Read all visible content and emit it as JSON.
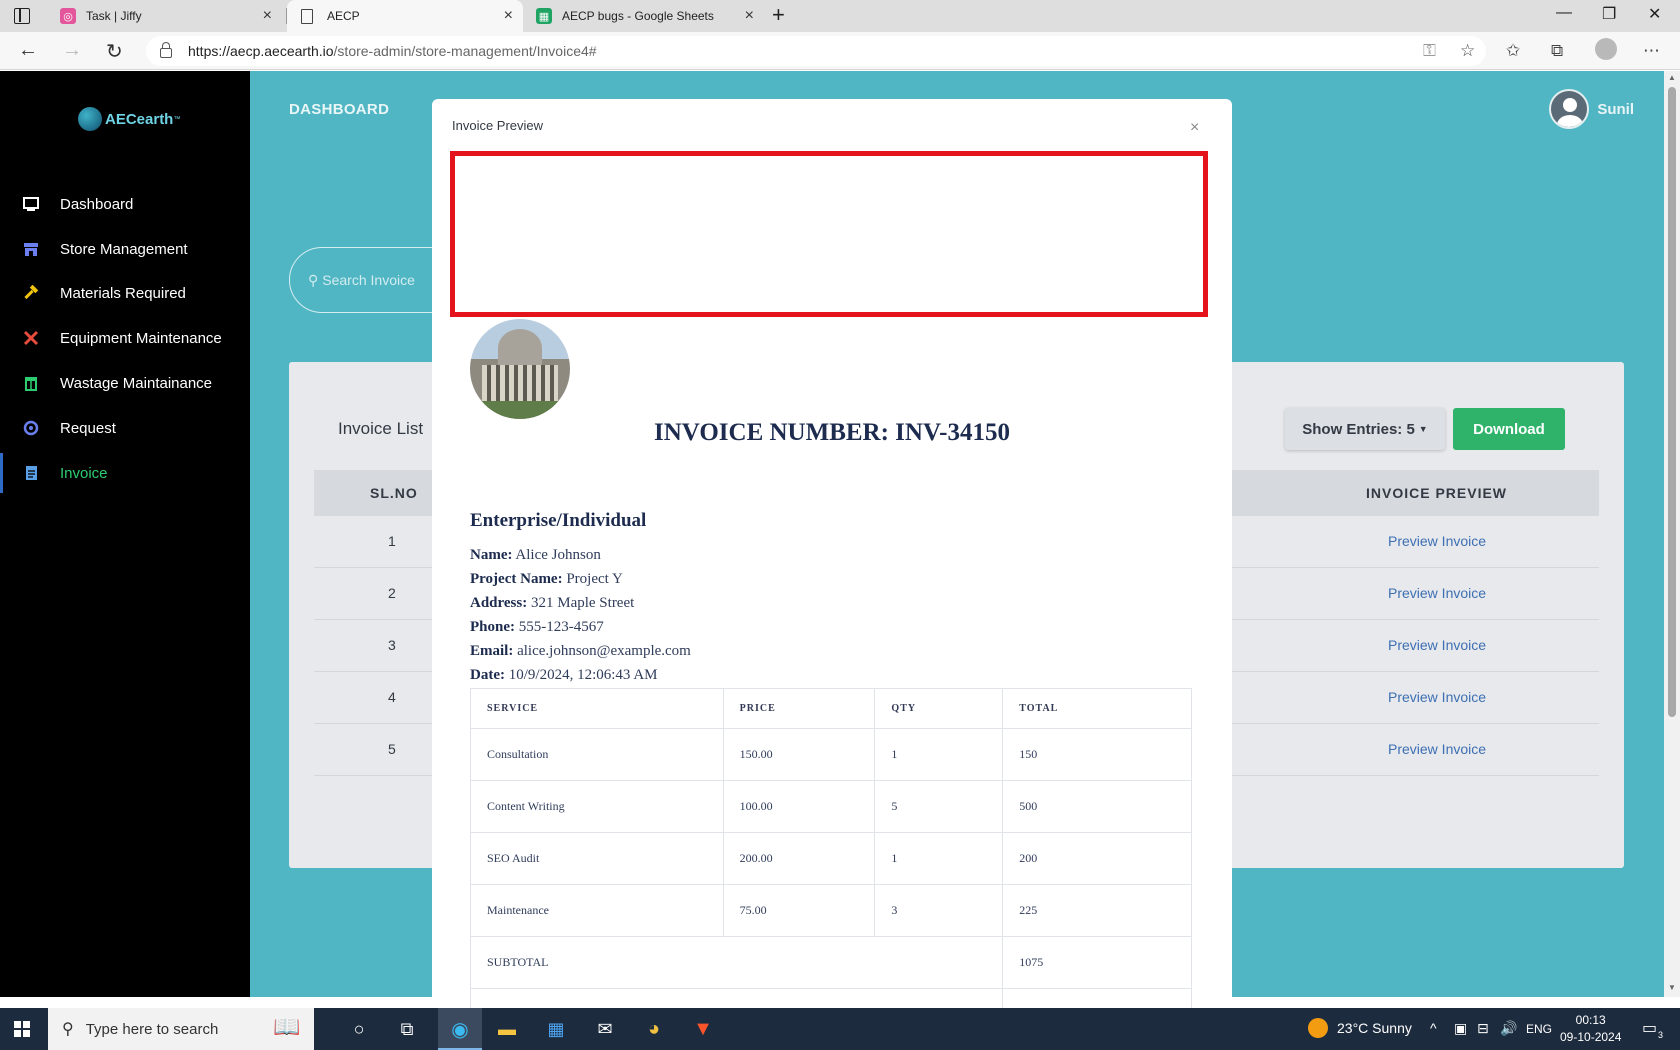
{
  "browser": {
    "tabs": [
      {
        "title": "Task | Jiffy"
      },
      {
        "title": "AECP"
      },
      {
        "title": "AECP bugs - Google Sheets"
      }
    ],
    "url_host": "https://aecp.aecearth.io",
    "url_path": "/store-admin/store-management/Invoice4#"
  },
  "sidebar": {
    "logo_text": "AECearth",
    "logo_tm": "™",
    "items": [
      {
        "label": "Dashboard",
        "icon": "monitor-icon"
      },
      {
        "label": "Store Management",
        "icon": "store-icon"
      },
      {
        "label": "Materials Required",
        "icon": "hammer-icon"
      },
      {
        "label": "Equipment Maintenance",
        "icon": "tools-icon"
      },
      {
        "label": "Wastage Maintainance",
        "icon": "trash-icon"
      },
      {
        "label": "Request",
        "icon": "request-icon"
      },
      {
        "label": "Invoice",
        "icon": "document-icon"
      }
    ],
    "active": "Invoice"
  },
  "header": {
    "title": "DASHBOARD",
    "user_name": "Sunil"
  },
  "search": {
    "placeholder": "Search Invoice"
  },
  "invoice_list": {
    "title": "Invoice List",
    "show_entries": "Show Entries: 5",
    "download": "Download",
    "columns": [
      "SL.NO",
      "INVOICE PREVIEW"
    ],
    "rows": [
      {
        "sl": "1",
        "preview": "Preview Invoice"
      },
      {
        "sl": "2",
        "preview": "Preview Invoice"
      },
      {
        "sl": "3",
        "preview": "Preview Invoice"
      },
      {
        "sl": "4",
        "preview": "Preview Invoice"
      },
      {
        "sl": "5",
        "preview": "Preview Invoice"
      }
    ]
  },
  "modal": {
    "title": "Invoice Preview",
    "close": "×",
    "invoice_number": "INVOICE NUMBER: INV-34150",
    "section": "Enterprise/Individual",
    "fields": [
      {
        "label": "Name:",
        "value": "Alice Johnson"
      },
      {
        "label": "Project Name:",
        "value": "Project Y"
      },
      {
        "label": "Address:",
        "value": "321 Maple Street"
      },
      {
        "label": "Phone:",
        "value": "555-123-4567"
      },
      {
        "label": "Email:",
        "value": "alice.johnson@example.com"
      },
      {
        "label": "Date:",
        "value": "10/9/2024, 12:06:43 AM"
      }
    ],
    "table": {
      "headers": [
        "SERVICE",
        "PRICE",
        "QTY",
        "TOTAL"
      ],
      "rows": [
        [
          "Consultation",
          "150.00",
          "1",
          "150"
        ],
        [
          "Content Writing",
          "100.00",
          "5",
          "500"
        ],
        [
          "SEO Audit",
          "200.00",
          "1",
          "200"
        ],
        [
          "Maintenance",
          "75.00",
          "3",
          "225"
        ]
      ],
      "subtotal_label": "SUBTOTAL",
      "subtotal_value": "1075"
    }
  },
  "taskbar": {
    "search_placeholder": "Type here to search",
    "weather": "23°C  Sunny",
    "lang": "ENG",
    "time": "00:13",
    "date": "09-10-2024",
    "notifications": "3"
  }
}
